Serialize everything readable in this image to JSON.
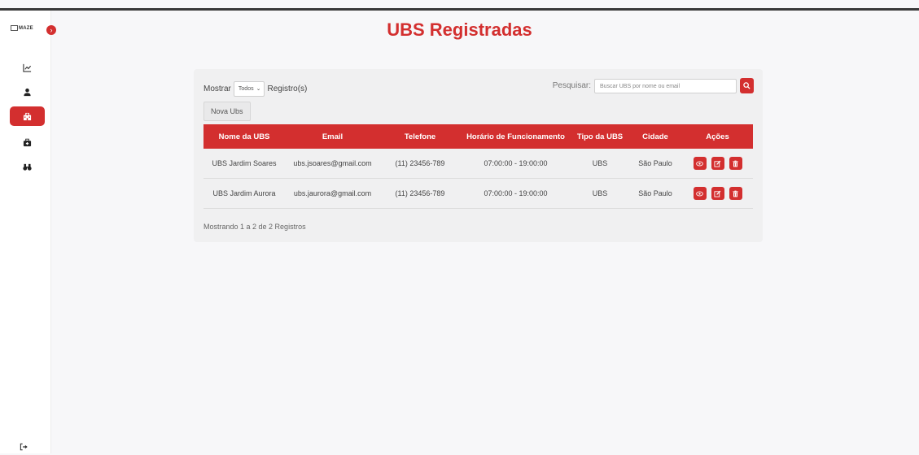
{
  "app": {
    "logo_text": "MAZE"
  },
  "sidebar": {
    "items": [
      {
        "name": "chart"
      },
      {
        "name": "user"
      },
      {
        "name": "hospital",
        "active": true
      },
      {
        "name": "briefcase"
      },
      {
        "name": "binoculars"
      }
    ]
  },
  "page": {
    "title": "UBS Registradas"
  },
  "controls": {
    "show_label": "Mostrar",
    "show_value": "Todos",
    "records_label": "Registro(s)",
    "search_label": "Pesquisar:",
    "search_placeholder": "Buscar UBS por nome ou email",
    "new_button": "Nova Ubs"
  },
  "table": {
    "headers": [
      "Nome da UBS",
      "Email",
      "Telefone",
      "Horário de Funcionamento",
      "Tipo da UBS",
      "Cidade",
      "Ações"
    ],
    "rows": [
      {
        "nome": "UBS Jardim Soares",
        "email": "ubs.jsoares@gmail.com",
        "telefone": "(11) 23456-789",
        "horario": "07:00:00 - 19:00:00",
        "tipo": "UBS",
        "cidade": "São Paulo"
      },
      {
        "nome": "UBS Jardim Aurora",
        "email": "ubs.jaurora@gmail.com",
        "telefone": "(11) 23456-789",
        "horario": "07:00:00 - 19:00:00",
        "tipo": "UBS",
        "cidade": "São Paulo"
      }
    ]
  },
  "footer": {
    "summary": "Mostrando 1 a 2 de 2 Registros"
  },
  "colors": {
    "accent": "#d32f2f",
    "background": "#f7f7f9",
    "card": "#f0f0f1"
  }
}
